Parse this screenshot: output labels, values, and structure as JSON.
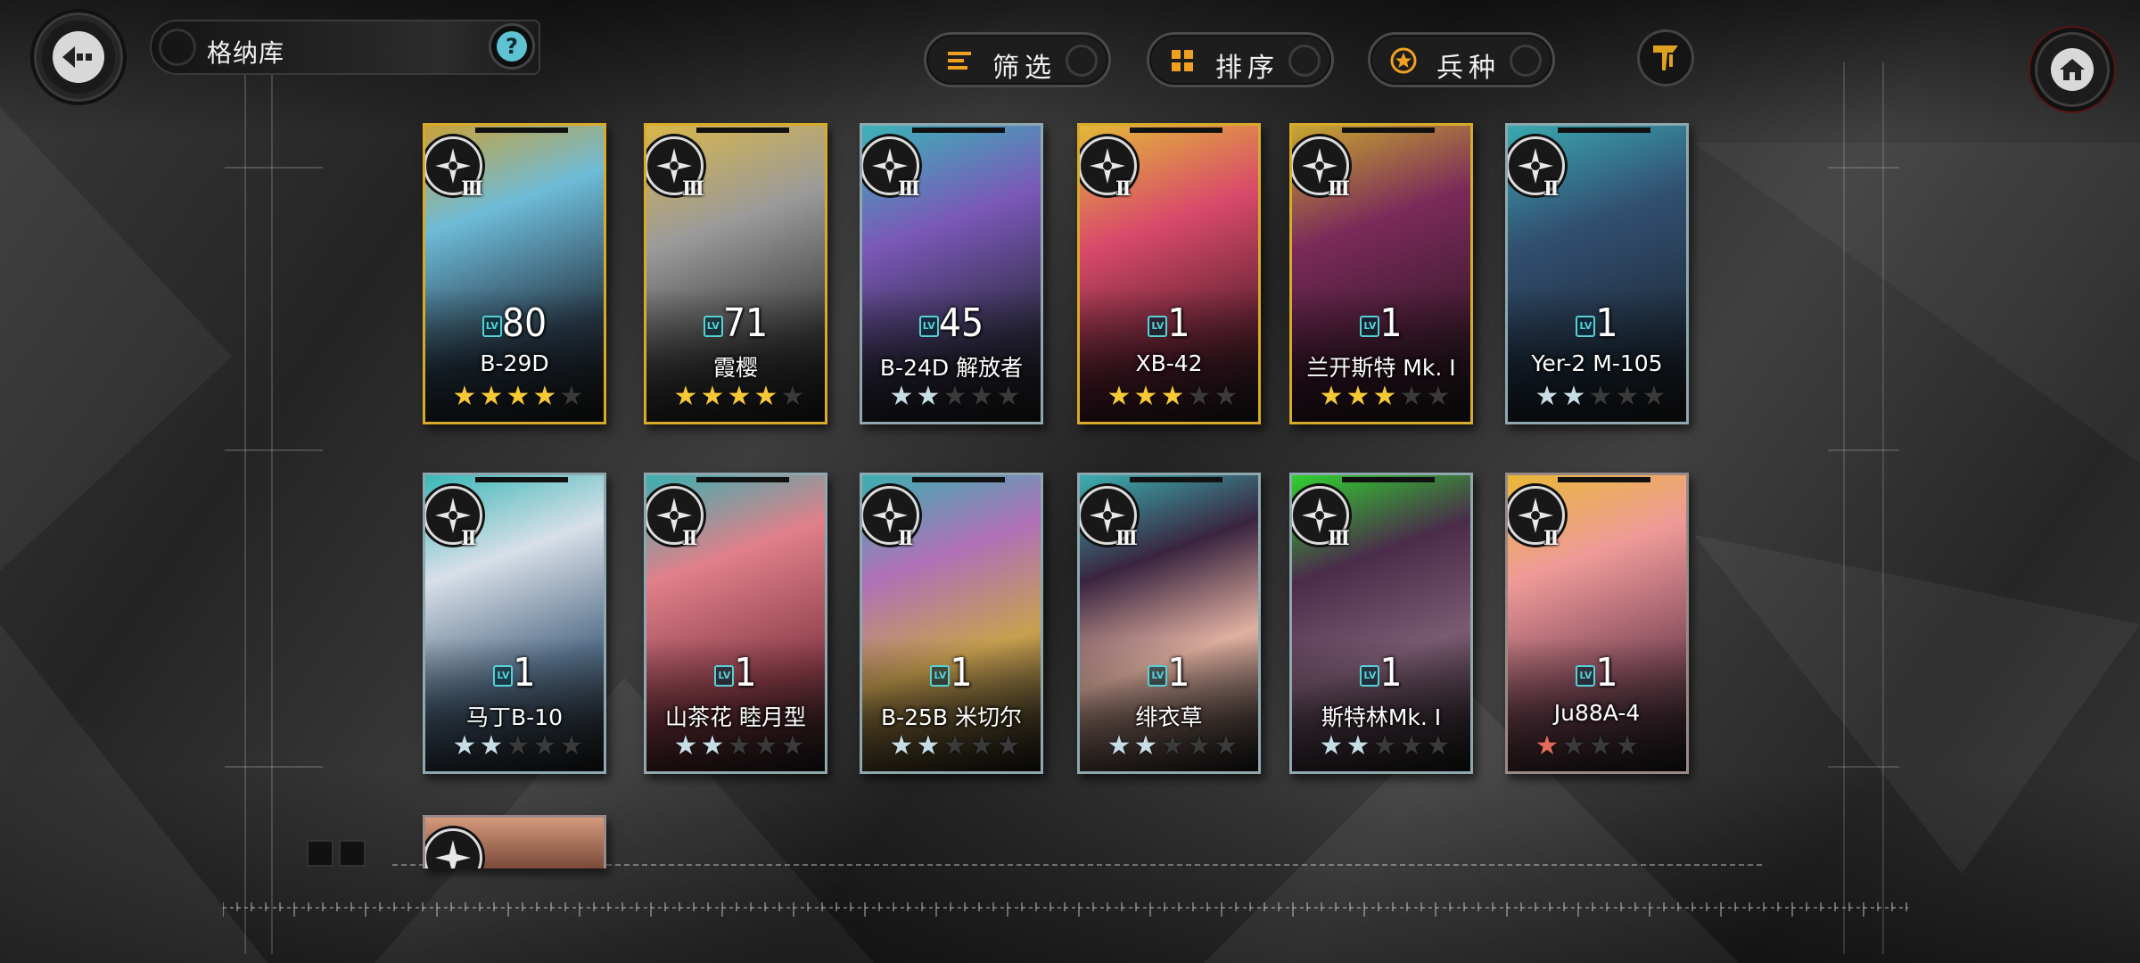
{
  "header": {
    "title": "格纳库",
    "help_label": "?"
  },
  "toolbar": {
    "filter_label": "筛选",
    "sort_label": "排序",
    "type_label": "兵种"
  },
  "colors": {
    "gold": "#d8aa2a",
    "teal": "#58d0d6",
    "red_accent": "#e36b5c"
  },
  "cards": [
    {
      "name": "B-29D",
      "level": "80",
      "tier": "III",
      "stars": 4,
      "max_stars": 5,
      "rarity": "gold"
    },
    {
      "name": "霞樱",
      "level": "71",
      "tier": "III",
      "stars": 4,
      "max_stars": 5,
      "rarity": "gold"
    },
    {
      "name": "B-24D 解放者",
      "level": "45",
      "tier": "III",
      "stars": 2,
      "max_stars": 5,
      "rarity": "silver"
    },
    {
      "name": "XB-42",
      "level": "1",
      "tier": "II",
      "stars": 3,
      "max_stars": 5,
      "rarity": "gold"
    },
    {
      "name": "兰开斯特 Mk. I",
      "level": "1",
      "tier": "III",
      "stars": 3,
      "max_stars": 5,
      "rarity": "gold"
    },
    {
      "name": "Yer-2 M-105",
      "level": "1",
      "tier": "II",
      "stars": 2,
      "max_stars": 5,
      "rarity": "silver"
    },
    {
      "name": "马丁B-10",
      "level": "1",
      "tier": "II",
      "stars": 2,
      "max_stars": 5,
      "rarity": "silver"
    },
    {
      "name": "山茶花 睦月型",
      "level": "1",
      "tier": "II",
      "stars": 2,
      "max_stars": 5,
      "rarity": "silver"
    },
    {
      "name": "B-25B 米切尔",
      "level": "1",
      "tier": "II",
      "stars": 2,
      "max_stars": 5,
      "rarity": "silver"
    },
    {
      "name": "绯衣草",
      "level": "1",
      "tier": "III",
      "stars": 2,
      "max_stars": 5,
      "rarity": "silver"
    },
    {
      "name": "斯特林Mk. I",
      "level": "1",
      "tier": "III",
      "stars": 2,
      "max_stars": 5,
      "rarity": "silver"
    },
    {
      "name": "Ju88A-4",
      "level": "1",
      "tier": "II",
      "stars": 1,
      "max_stars": 4,
      "rarity": "red"
    }
  ]
}
